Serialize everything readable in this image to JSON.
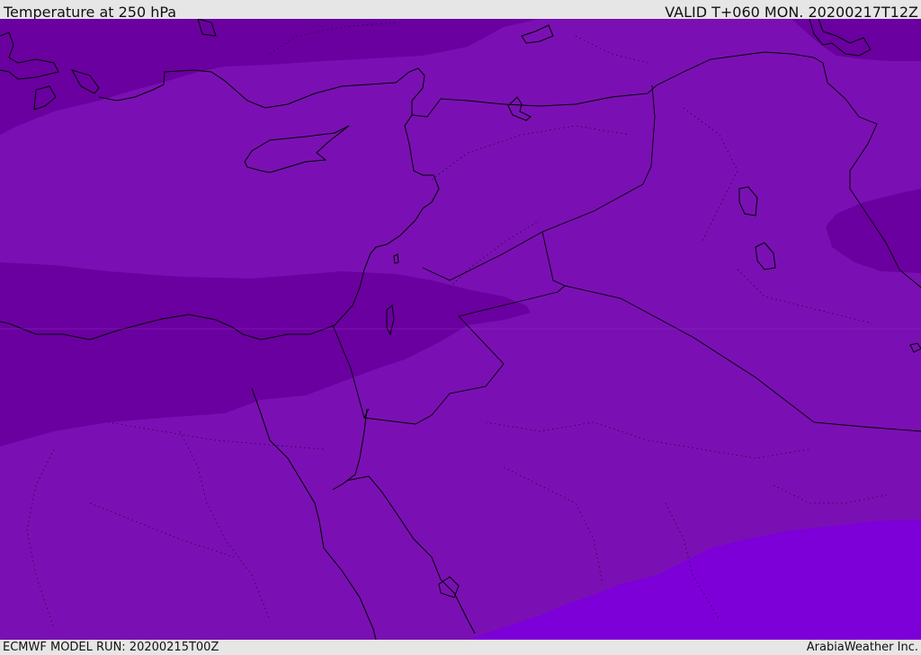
{
  "header": {
    "title": "Temperature at 250 hPa",
    "valid_time": "VALID T+060 MON. 20200217T12Z"
  },
  "footer": {
    "model_run": "ECMWF MODEL RUN: 20200215T00Z",
    "credit": "ArabiaWeather Inc."
  },
  "map": {
    "colors": {
      "base": "#7a10b3",
      "cold_band": "#6a009f",
      "warm_area": "#7d00d8",
      "coastline": "#000000",
      "borders": "#000000"
    }
  }
}
